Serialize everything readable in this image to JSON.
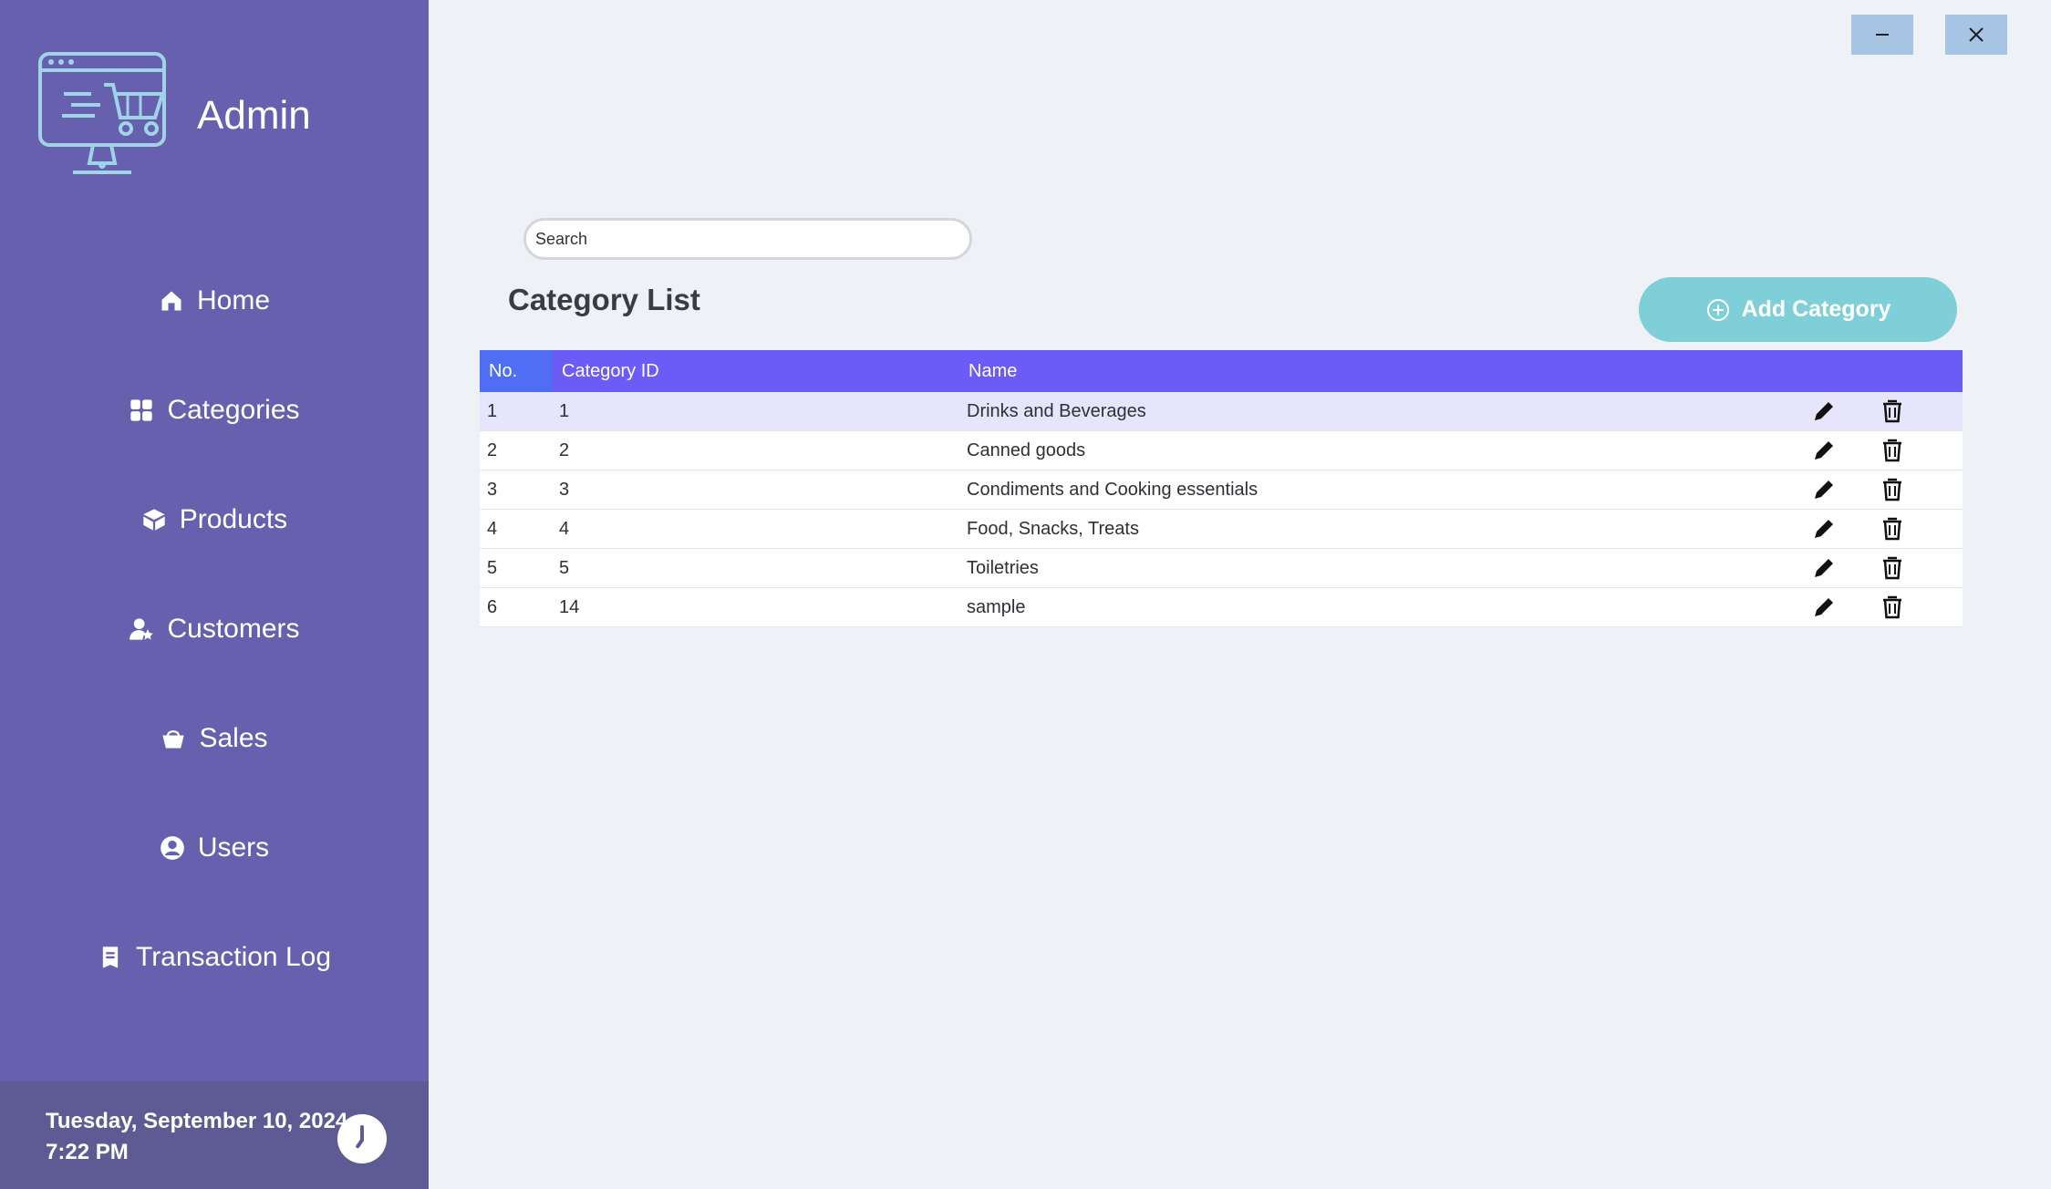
{
  "app": {
    "brand_title": "Admin"
  },
  "sidebar": {
    "items": [
      {
        "label": "Home",
        "icon": "home-icon"
      },
      {
        "label": "Categories",
        "icon": "grid-icon"
      },
      {
        "label": "Products",
        "icon": "box-icon"
      },
      {
        "label": "Customers",
        "icon": "customer-icon"
      },
      {
        "label": "Sales",
        "icon": "basket-icon"
      },
      {
        "label": "Users",
        "icon": "user-icon"
      },
      {
        "label": "Transaction Log",
        "icon": "receipt-icon"
      }
    ],
    "footer": {
      "date": "Tuesday, September 10, 2024",
      "time": "7:22 PM"
    }
  },
  "window_controls": {
    "minimize_icon": "minimize-icon",
    "close_icon": "close-icon"
  },
  "main": {
    "search": {
      "placeholder": "Search",
      "value": ""
    },
    "title": "Category List",
    "add_button_label": "Add Category",
    "table": {
      "columns": [
        "No.",
        "Category ID",
        "Name"
      ],
      "rows": [
        {
          "no": "1",
          "id": "1",
          "name": "Drinks and Beverages"
        },
        {
          "no": "2",
          "id": "2",
          "name": "Canned goods"
        },
        {
          "no": "3",
          "id": "3",
          "name": "Condiments and Cooking essentials"
        },
        {
          "no": "4",
          "id": "4",
          "name": "Food, Snacks, Treats"
        },
        {
          "no": "5",
          "id": "5",
          "name": "Toiletries"
        },
        {
          "no": "6",
          "id": "14",
          "name": "sample"
        }
      ]
    }
  },
  "colors": {
    "sidebar_bg": "#6660ae",
    "sidebar_footer_bg": "#5d5a94",
    "table_header_bg": "#6b5cf7",
    "table_header_no_bg": "#4f6ef3",
    "selected_row_bg": "#e6e5fb",
    "add_button_bg": "#7fcfd9",
    "window_button_bg": "#a8c4e4",
    "logo_accent": "#9fd4e6"
  }
}
